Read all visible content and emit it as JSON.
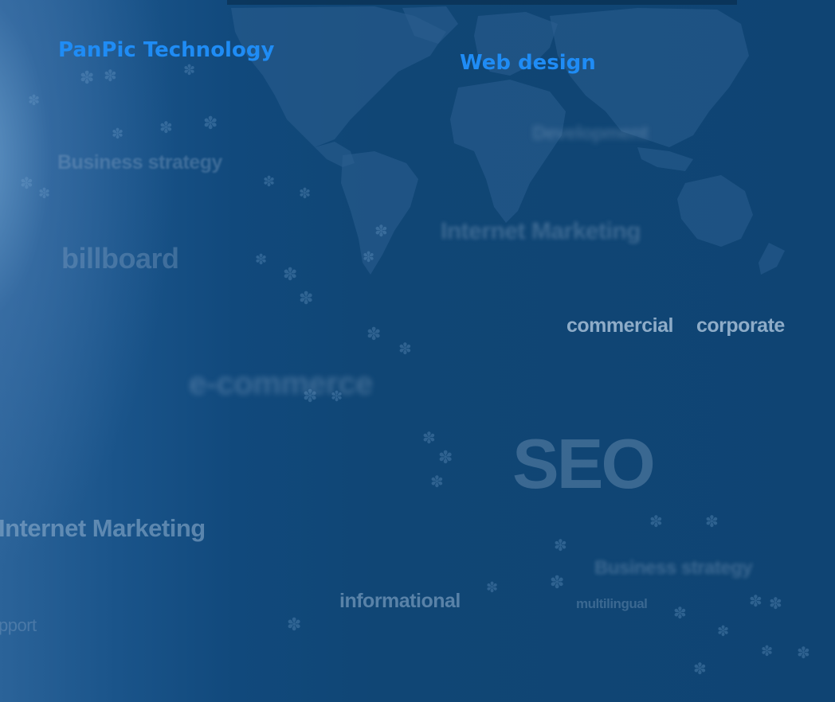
{
  "header": {
    "brand_link": "PanPic Technology",
    "web_design_link": "Web design"
  },
  "background_words": {
    "business_strategy": "Business strategy",
    "billboard": "billboard",
    "development": "Development",
    "internet_marketing_blurred": "Internet Marketing",
    "commercial": "commercial",
    "corporate": "corporate",
    "ecommerce_blurred": "e-commerce",
    "seo": "SEO",
    "internet_marketing": "Internet Marketing",
    "business_strategy_blurred": "Business strategy",
    "informational": "informational",
    "multilingual": "multilingual",
    "support": "pport"
  },
  "colors": {
    "link_blue": "#1f8cf5",
    "background_blue": "#104675"
  }
}
